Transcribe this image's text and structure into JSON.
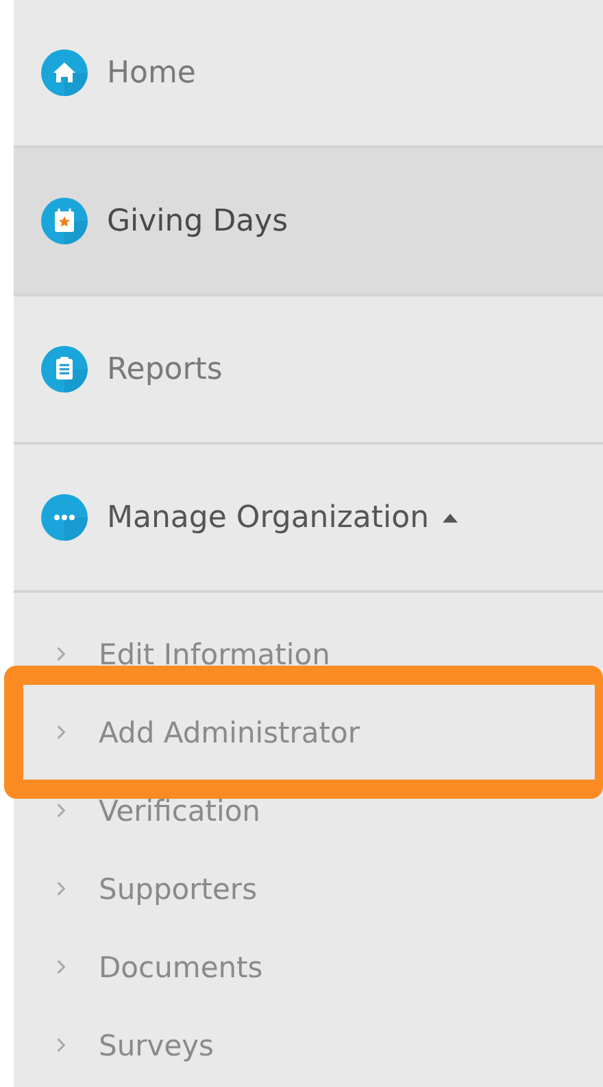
{
  "sidebar": {
    "items": [
      {
        "label": "Home",
        "selected": false
      },
      {
        "label": "Giving Days",
        "selected": true
      },
      {
        "label": "Reports",
        "selected": false
      },
      {
        "label": "Manage Organization",
        "selected": false,
        "expanded": true,
        "children": [
          {
            "label": "Edit Information",
            "highlighted": false
          },
          {
            "label": "Add Administrator",
            "highlighted": true
          },
          {
            "label": "Verification",
            "highlighted": false
          },
          {
            "label": "Supporters",
            "highlighted": false
          },
          {
            "label": "Documents",
            "highlighted": false
          },
          {
            "label": "Surveys",
            "highlighted": false
          }
        ]
      }
    ]
  }
}
